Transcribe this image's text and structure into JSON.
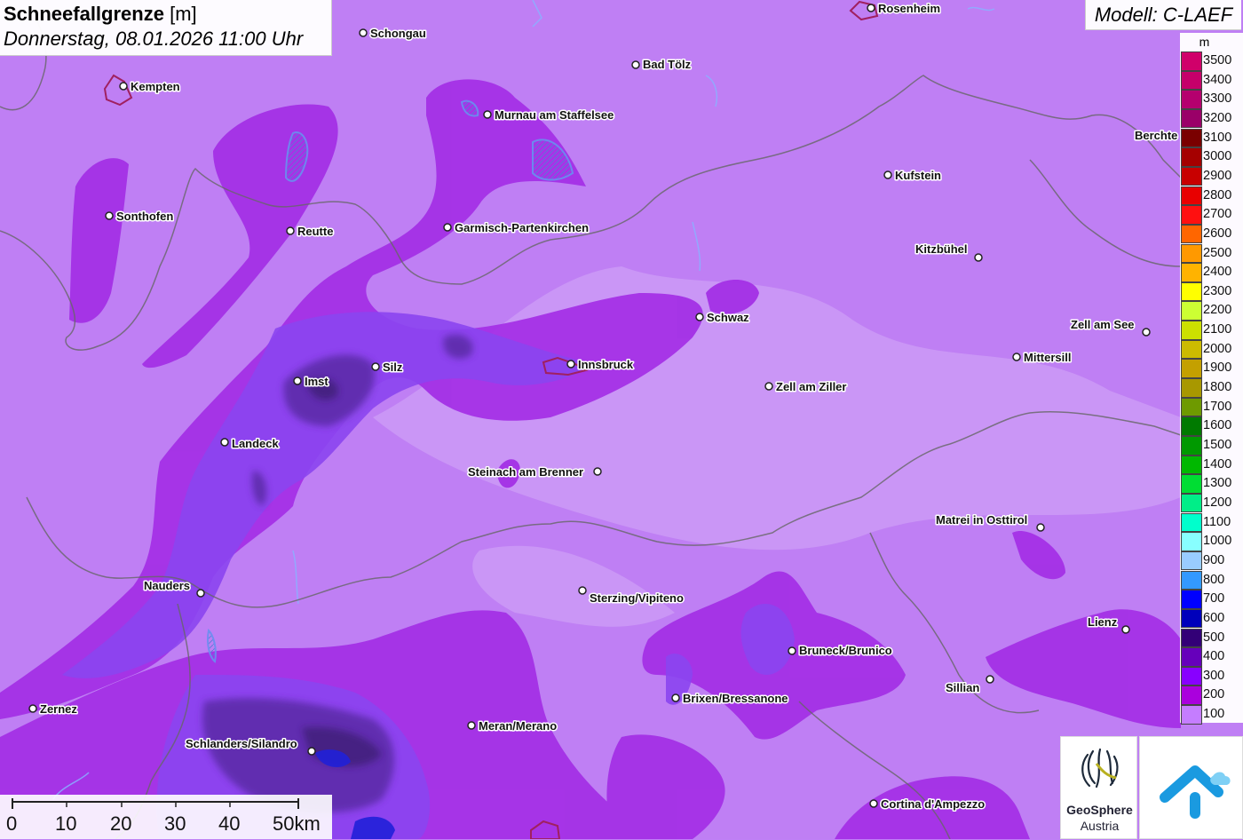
{
  "title": {
    "variable": "Schneefallgrenze",
    "unit": "[m]",
    "datetime": "Donnerstag, 08.01.2026 11:00 Uhr"
  },
  "model": "Modell: C-LAEF",
  "legend": {
    "unit": "m",
    "entries": [
      {
        "value": "3500",
        "color": "#d0006a"
      },
      {
        "value": "3400",
        "color": "#c5006a"
      },
      {
        "value": "3300",
        "color": "#b5006e"
      },
      {
        "value": "3200",
        "color": "#9a0068"
      },
      {
        "value": "3100",
        "color": "#7a0000"
      },
      {
        "value": "3000",
        "color": "#a50000"
      },
      {
        "value": "2900",
        "color": "#c80000"
      },
      {
        "value": "2800",
        "color": "#e80000"
      },
      {
        "value": "2700",
        "color": "#ff1010"
      },
      {
        "value": "2600",
        "color": "#ff6600"
      },
      {
        "value": "2500",
        "color": "#ff9900"
      },
      {
        "value": "2400",
        "color": "#ffb300"
      },
      {
        "value": "2300",
        "color": "#ffff00"
      },
      {
        "value": "2200",
        "color": "#ccff33"
      },
      {
        "value": "2100",
        "color": "#cce000"
      },
      {
        "value": "2000",
        "color": "#ccbb00"
      },
      {
        "value": "1900",
        "color": "#c4a000"
      },
      {
        "value": "1800",
        "color": "#a89800"
      },
      {
        "value": "1700",
        "color": "#6e9a00"
      },
      {
        "value": "1600",
        "color": "#007a00"
      },
      {
        "value": "1500",
        "color": "#009900"
      },
      {
        "value": "1400",
        "color": "#00b800"
      },
      {
        "value": "1300",
        "color": "#00dd33"
      },
      {
        "value": "1200",
        "color": "#00ee88"
      },
      {
        "value": "1100",
        "color": "#00ffcc"
      },
      {
        "value": "1000",
        "color": "#88ffff"
      },
      {
        "value": "900",
        "color": "#99ccff"
      },
      {
        "value": "800",
        "color": "#3399ff"
      },
      {
        "value": "700",
        "color": "#0000ff"
      },
      {
        "value": "600",
        "color": "#0000bb"
      },
      {
        "value": "500",
        "color": "#330077"
      },
      {
        "value": "400",
        "color": "#6600bb"
      },
      {
        "value": "300",
        "color": "#8800ff"
      },
      {
        "value": "200",
        "color": "#aa00dd"
      },
      {
        "value": "100",
        "color": "#c57dff"
      }
    ]
  },
  "cities": [
    {
      "name": "Rosenheim",
      "id": "rosenheim"
    },
    {
      "name": "Schongau",
      "id": "schongau"
    },
    {
      "name": "Kempten",
      "id": "kempten"
    },
    {
      "name": "Bad Tölz",
      "id": "bad-toelz"
    },
    {
      "name": "Murnau am Staffelsee",
      "id": "murnau"
    },
    {
      "name": "Berchte",
      "id": "berchtesgaden"
    },
    {
      "name": "Kufstein",
      "id": "kufstein"
    },
    {
      "name": "Sonthofen",
      "id": "sonthofen"
    },
    {
      "name": "Reutte",
      "id": "reutte"
    },
    {
      "name": "Garmisch-Partenkirchen",
      "id": "garmisch"
    },
    {
      "name": "Kitzbühel",
      "id": "kitzbuehel"
    },
    {
      "name": "Schwaz",
      "id": "schwaz"
    },
    {
      "name": "Zell am See",
      "id": "zell-am-see"
    },
    {
      "name": "Mittersill",
      "id": "mittersill"
    },
    {
      "name": "Innsbruck",
      "id": "innsbruck"
    },
    {
      "name": "Silz",
      "id": "silz"
    },
    {
      "name": "Imst",
      "id": "imst"
    },
    {
      "name": "Zell am Ziller",
      "id": "zell-am-ziller"
    },
    {
      "name": "Landeck",
      "id": "landeck"
    },
    {
      "name": "Steinach am Brenner",
      "id": "steinach"
    },
    {
      "name": "Matrei in Osttirol",
      "id": "matrei"
    },
    {
      "name": "Nauders",
      "id": "nauders"
    },
    {
      "name": "Sterzing/Vipiteno",
      "id": "sterzing"
    },
    {
      "name": "Lienz",
      "id": "lienz"
    },
    {
      "name": "Bruneck/Brunico",
      "id": "bruneck"
    },
    {
      "name": "Sillian",
      "id": "sillian"
    },
    {
      "name": "Brixen/Bressanone",
      "id": "brixen"
    },
    {
      "name": "Zernez",
      "id": "zernez"
    },
    {
      "name": "Meran/Merano",
      "id": "meran"
    },
    {
      "name": "Schlanders/Silandro",
      "id": "schlanders"
    },
    {
      "name": "Cortina d'Ampezzo",
      "id": "cortina"
    }
  ],
  "scalebar": {
    "labels": [
      "0",
      "10",
      "20",
      "30",
      "40",
      "50km"
    ]
  },
  "logos": {
    "geosphere_line1": "GeoSphere",
    "geosphere_line2": "Austria"
  }
}
